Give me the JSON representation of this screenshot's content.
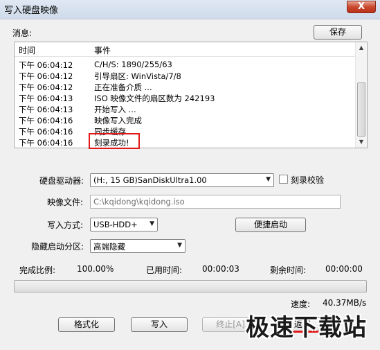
{
  "window": {
    "title": "写入硬盘映像",
    "close_glyph": "X"
  },
  "messages": {
    "label": "消息:",
    "save_button": "保存",
    "columns": [
      "时间",
      "事件"
    ],
    "rows": [
      {
        "time": "下午 06:04:12",
        "event": "C/H/S: 1890/255/63"
      },
      {
        "time": "下午 06:04:12",
        "event": "引导扇区: WinVista/7/8"
      },
      {
        "time": "下午 06:04:12",
        "event": "正在准备介质 ..."
      },
      {
        "time": "下午 06:04:13",
        "event": "ISO 映像文件的扇区数为 242193"
      },
      {
        "time": "下午 06:04:13",
        "event": "开始写入 ..."
      },
      {
        "time": "下午 06:04:16",
        "event": "映像写入完成"
      },
      {
        "time": "下午 06:04:16",
        "event": "同步缓存 ..."
      },
      {
        "time": "下午 06:04:16",
        "event": "刻录成功!"
      }
    ]
  },
  "drive": {
    "label": "硬盘驱动器:",
    "value": "(H:, 15 GB)SanDiskUltra1.00",
    "verify_label": "刻录校验"
  },
  "image_file": {
    "label": "映像文件:",
    "value": "C:\\kqidong\\kqidong.iso"
  },
  "write_mode": {
    "label": "写入方式:",
    "value": "USB-HDD+",
    "quick_boot_button": "便捷启动"
  },
  "hidden_partition": {
    "label": "隐藏启动分区:",
    "value": "高端隐藏"
  },
  "status": {
    "percent_label": "完成比例:",
    "percent_value": "100.00%",
    "elapsed_label": "已用时间:",
    "elapsed_value": "00:00:03",
    "remaining_label": "剩余时间:",
    "remaining_value": "00:00:00",
    "progress": 0,
    "speed_label": "速度:",
    "speed_value": "40.37MB/s"
  },
  "buttons": {
    "format": "格式化",
    "write": "写入",
    "stop": "终止[A]",
    "return": "返回"
  },
  "watermark": "极速下载站",
  "colors": {
    "highlight": "#e01818",
    "titlebar": "#cfdbea"
  }
}
